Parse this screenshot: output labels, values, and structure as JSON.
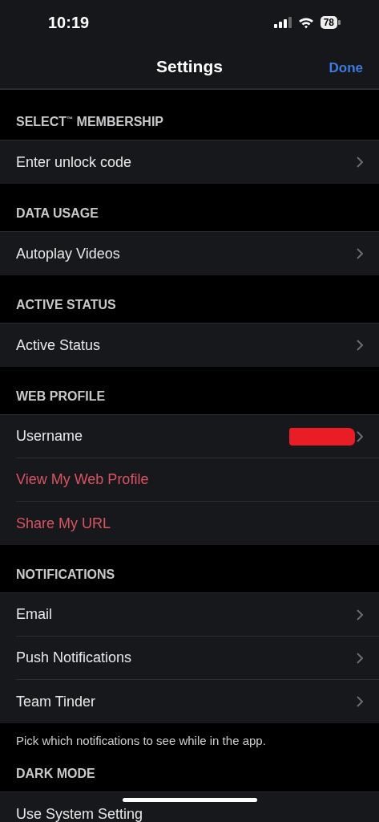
{
  "status_bar": {
    "time": "10:19",
    "battery": "78"
  },
  "nav": {
    "title": "Settings",
    "done": "Done"
  },
  "sections": [
    {
      "header": "SELECT$^{™}$ MEMBERSHIP",
      "rows": [
        {
          "label": "Enter unlock code",
          "kind": "nav"
        }
      ]
    },
    {
      "header": "DATA USAGE",
      "rows": [
        {
          "label": "Autoplay Videos",
          "kind": "nav"
        }
      ]
    },
    {
      "header": "ACTIVE STATUS",
      "rows": [
        {
          "label": "Active Status",
          "kind": "nav"
        }
      ]
    },
    {
      "header": "WEB PROFILE",
      "rows": [
        {
          "label": "Username",
          "kind": "redacted"
        },
        {
          "label": "View My Web Profile",
          "kind": "link"
        },
        {
          "label": "Share My URL",
          "kind": "link"
        }
      ]
    },
    {
      "header": "NOTIFICATIONS",
      "rows": [
        {
          "label": "Email",
          "kind": "nav"
        },
        {
          "label": "Push Notifications",
          "kind": "nav"
        },
        {
          "label": "Team Tinder",
          "kind": "nav"
        }
      ],
      "note": "Pick which notifications to see while in the app."
    },
    {
      "header": "DARK MODE",
      "rows": [
        {
          "label": "Use System Setting",
          "kind": "plain"
        }
      ]
    }
  ]
}
